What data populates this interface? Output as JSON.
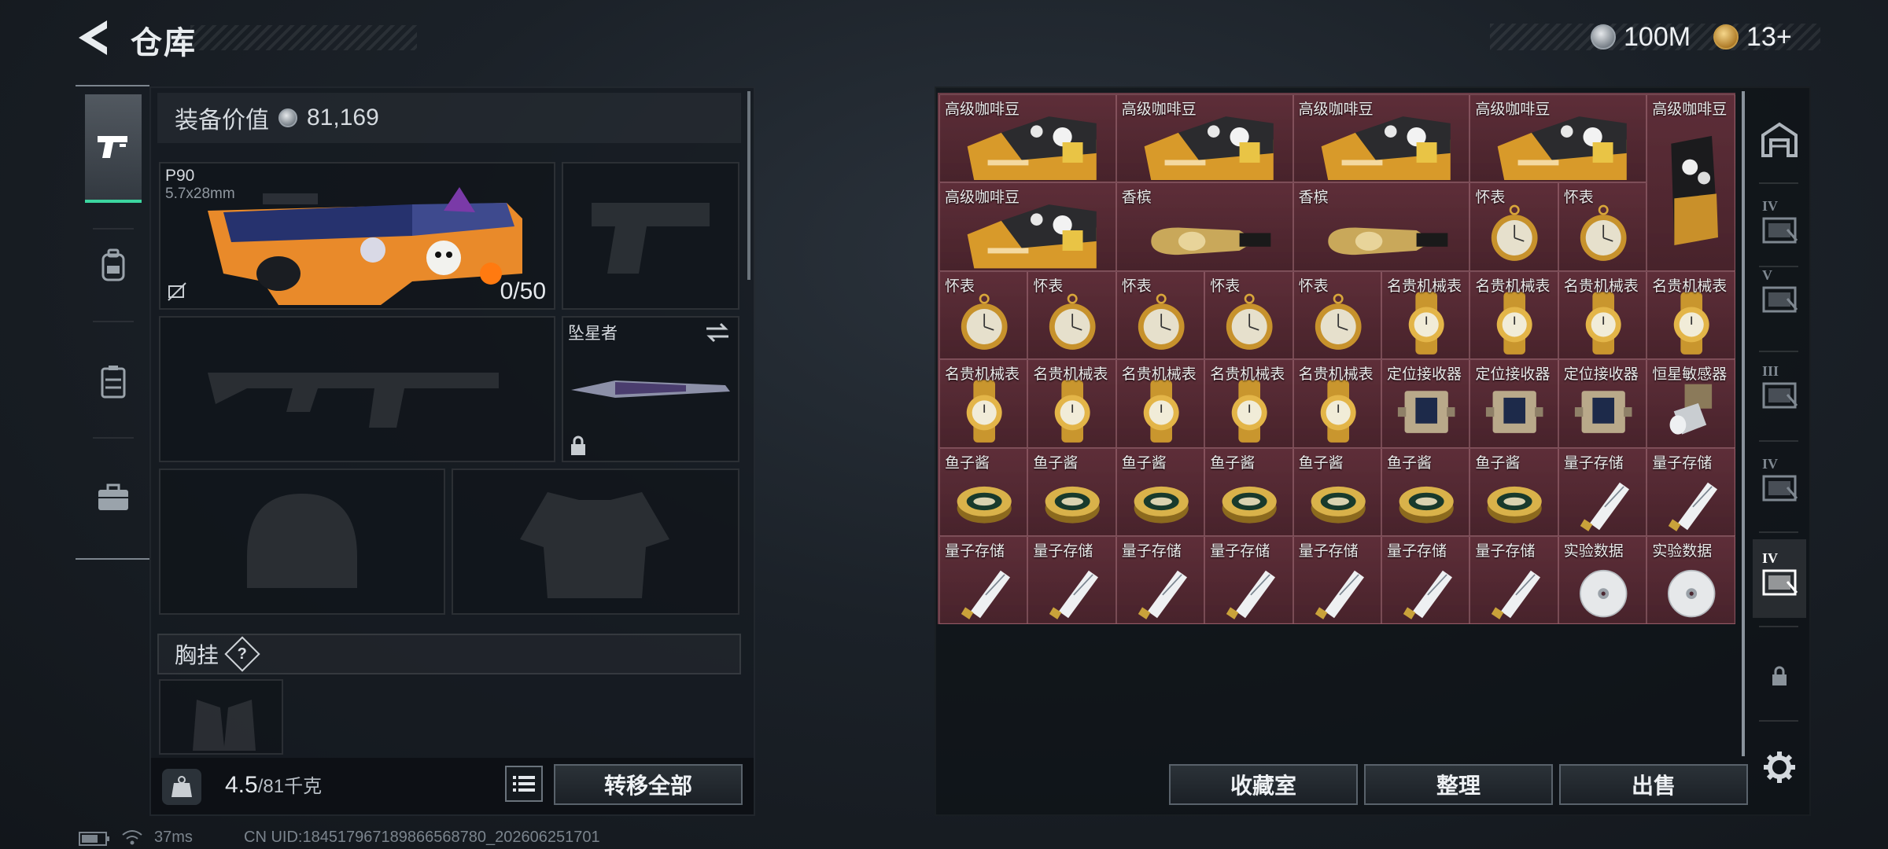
{
  "topbar": {
    "back_label": "back",
    "title": "仓库",
    "currencies": [
      {
        "icon": "silver-coin-icon",
        "value": "100M"
      },
      {
        "icon": "gold-token-icon",
        "value": "13+"
      }
    ]
  },
  "left_rail": {
    "items": [
      {
        "name": "weapons",
        "icon": "pistol-icon",
        "active": true
      },
      {
        "name": "backpack",
        "icon": "backpack-icon",
        "active": false
      },
      {
        "name": "vest",
        "icon": "chest-rig-icon",
        "active": false
      },
      {
        "name": "case",
        "icon": "briefcase-icon",
        "active": false
      }
    ]
  },
  "loadout": {
    "value_label": "装备价值",
    "value": "81,169",
    "primary": {
      "name": "P90",
      "caliber": "5.7x28mm",
      "ammo": "0/50"
    },
    "melee": {
      "name": "坠星者"
    },
    "chest_rig_label": "胸挂",
    "chest_rig_help": "?",
    "weight_current": "4.5",
    "weight_max": "/81千克",
    "transfer_all": "转移全部"
  },
  "storage": {
    "accent": "#4a2730",
    "items": [
      {
        "name": "高级咖啡豆",
        "type": "coffee",
        "w": 2,
        "h": 1,
        "col": 0,
        "row": 0
      },
      {
        "name": "高级咖啡豆",
        "type": "coffee",
        "w": 2,
        "h": 1,
        "col": 2,
        "row": 0
      },
      {
        "name": "高级咖啡豆",
        "type": "coffee",
        "w": 2,
        "h": 1,
        "col": 4,
        "row": 0
      },
      {
        "name": "高级咖啡豆",
        "type": "coffee",
        "w": 2,
        "h": 1,
        "col": 6,
        "row": 0
      },
      {
        "name": "高级咖啡豆",
        "type": "coffee-tall",
        "w": 1,
        "h": 2,
        "col": 8,
        "row": 0
      },
      {
        "name": "高级咖啡豆",
        "type": "coffee",
        "w": 2,
        "h": 1,
        "col": 0,
        "row": 1
      },
      {
        "name": "香槟",
        "type": "champagne",
        "w": 2,
        "h": 1,
        "col": 2,
        "row": 1
      },
      {
        "name": "香槟",
        "type": "champagne",
        "w": 2,
        "h": 1,
        "col": 4,
        "row": 1
      },
      {
        "name": "怀表",
        "type": "pocketwatch",
        "w": 1,
        "h": 1,
        "col": 6,
        "row": 1
      },
      {
        "name": "怀表",
        "type": "pocketwatch",
        "w": 1,
        "h": 1,
        "col": 7,
        "row": 1
      },
      {
        "name": "怀表",
        "type": "pocketwatch",
        "w": 1,
        "h": 1,
        "col": 0,
        "row": 2
      },
      {
        "name": "怀表",
        "type": "pocketwatch",
        "w": 1,
        "h": 1,
        "col": 1,
        "row": 2
      },
      {
        "name": "怀表",
        "type": "pocketwatch",
        "w": 1,
        "h": 1,
        "col": 2,
        "row": 2
      },
      {
        "name": "怀表",
        "type": "pocketwatch",
        "w": 1,
        "h": 1,
        "col": 3,
        "row": 2
      },
      {
        "name": "怀表",
        "type": "pocketwatch",
        "w": 1,
        "h": 1,
        "col": 4,
        "row": 2
      },
      {
        "name": "名贵机械表",
        "type": "wristwatch",
        "w": 1,
        "h": 1,
        "col": 5,
        "row": 2
      },
      {
        "name": "名贵机械表",
        "type": "wristwatch",
        "w": 1,
        "h": 1,
        "col": 6,
        "row": 2
      },
      {
        "name": "名贵机械表",
        "type": "wristwatch",
        "w": 1,
        "h": 1,
        "col": 7,
        "row": 2
      },
      {
        "name": "名贵机械表",
        "type": "wristwatch",
        "w": 1,
        "h": 1,
        "col": 8,
        "row": 2
      },
      {
        "name": "名贵机械表",
        "type": "wristwatch",
        "w": 1,
        "h": 1,
        "col": 0,
        "row": 3
      },
      {
        "name": "名贵机械表",
        "type": "wristwatch",
        "w": 1,
        "h": 1,
        "col": 1,
        "row": 3
      },
      {
        "name": "名贵机械表",
        "type": "wristwatch",
        "w": 1,
        "h": 1,
        "col": 2,
        "row": 3
      },
      {
        "name": "名贵机械表",
        "type": "wristwatch",
        "w": 1,
        "h": 1,
        "col": 3,
        "row": 3
      },
      {
        "name": "名贵机械表",
        "type": "wristwatch",
        "w": 1,
        "h": 1,
        "col": 4,
        "row": 3
      },
      {
        "name": "定位接收器",
        "type": "receiver",
        "w": 1,
        "h": 1,
        "col": 5,
        "row": 3
      },
      {
        "name": "定位接收器",
        "type": "receiver",
        "w": 1,
        "h": 1,
        "col": 6,
        "row": 3
      },
      {
        "name": "定位接收器",
        "type": "receiver",
        "w": 1,
        "h": 1,
        "col": 7,
        "row": 3
      },
      {
        "name": "恒星敏感器",
        "type": "sensor",
        "w": 1,
        "h": 1,
        "col": 8,
        "row": 3
      },
      {
        "name": "鱼子酱",
        "type": "caviar",
        "w": 1,
        "h": 1,
        "col": 0,
        "row": 4
      },
      {
        "name": "鱼子酱",
        "type": "caviar",
        "w": 1,
        "h": 1,
        "col": 1,
        "row": 4
      },
      {
        "name": "鱼子酱",
        "type": "caviar",
        "w": 1,
        "h": 1,
        "col": 2,
        "row": 4
      },
      {
        "name": "鱼子酱",
        "type": "caviar",
        "w": 1,
        "h": 1,
        "col": 3,
        "row": 4
      },
      {
        "name": "鱼子酱",
        "type": "caviar",
        "w": 1,
        "h": 1,
        "col": 4,
        "row": 4
      },
      {
        "name": "鱼子酱",
        "type": "caviar",
        "w": 1,
        "h": 1,
        "col": 5,
        "row": 4
      },
      {
        "name": "鱼子酱",
        "type": "caviar",
        "w": 1,
        "h": 1,
        "col": 6,
        "row": 4
      },
      {
        "name": "量子存储",
        "type": "usb",
        "w": 1,
        "h": 1,
        "col": 7,
        "row": 4
      },
      {
        "name": "量子存储",
        "type": "usb",
        "w": 1,
        "h": 1,
        "col": 8,
        "row": 4
      },
      {
        "name": "量子存储",
        "type": "usb",
        "w": 1,
        "h": 1,
        "col": 0,
        "row": 5
      },
      {
        "name": "量子存储",
        "type": "usb",
        "w": 1,
        "h": 1,
        "col": 1,
        "row": 5
      },
      {
        "name": "量子存储",
        "type": "usb",
        "w": 1,
        "h": 1,
        "col": 2,
        "row": 5
      },
      {
        "name": "量子存储",
        "type": "usb",
        "w": 1,
        "h": 1,
        "col": 3,
        "row": 5
      },
      {
        "name": "量子存储",
        "type": "usb",
        "w": 1,
        "h": 1,
        "col": 4,
        "row": 5
      },
      {
        "name": "量子存储",
        "type": "usb",
        "w": 1,
        "h": 1,
        "col": 5,
        "row": 5
      },
      {
        "name": "量子存储",
        "type": "usb",
        "w": 1,
        "h": 1,
        "col": 6,
        "row": 5
      },
      {
        "name": "实验数据",
        "type": "disc",
        "w": 1,
        "h": 1,
        "col": 7,
        "row": 5
      },
      {
        "name": "实验数据",
        "type": "disc",
        "w": 1,
        "h": 1,
        "col": 8,
        "row": 5
      }
    ],
    "buttons": {
      "collection": "收藏室",
      "organize": "整理",
      "sell": "出售"
    }
  },
  "right_rail": {
    "items": [
      {
        "name": "storage-main",
        "icon": "warehouse-icon",
        "label": ""
      },
      {
        "name": "storage-4",
        "icon": "storage-tab-icon",
        "label": "IV"
      },
      {
        "name": "storage-5",
        "icon": "storage-tab-icon",
        "label": "V"
      },
      {
        "name": "storage-3",
        "icon": "storage-tab-icon",
        "label": "III"
      },
      {
        "name": "storage-4b",
        "icon": "storage-tab-icon",
        "label": "IV"
      },
      {
        "name": "storage-active",
        "icon": "storage-tab-icon",
        "label": "IV"
      },
      {
        "name": "storage-locked",
        "icon": "lock-icon",
        "label": ""
      }
    ]
  },
  "footer": {
    "ping": "37ms",
    "uid": "CN UID:184517967189866568780_202606251701"
  }
}
